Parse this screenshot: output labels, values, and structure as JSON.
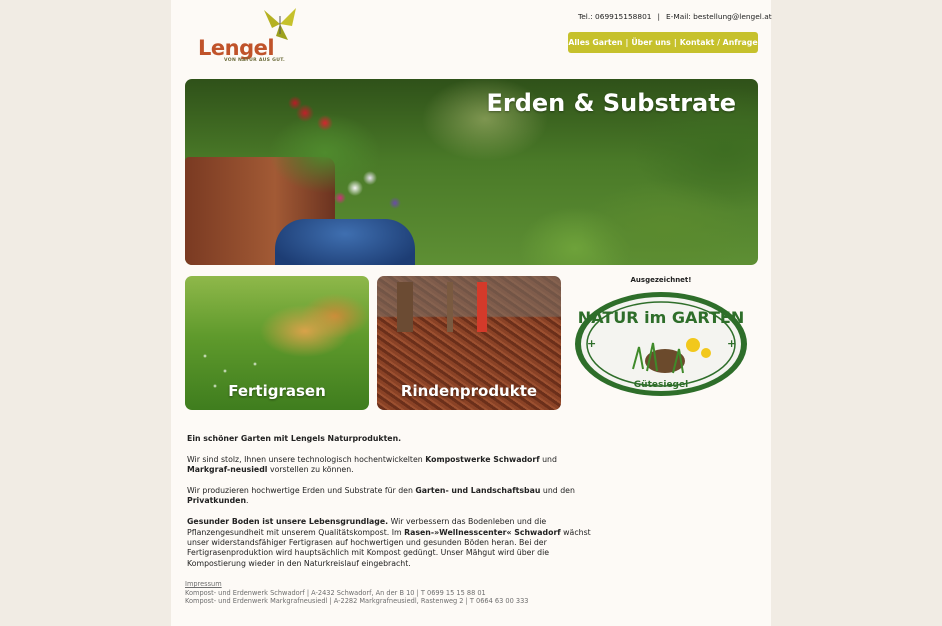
{
  "header": {
    "logo_text": "Lengel",
    "logo_tagline": "VON NATUR AUS GUT.",
    "phone": "Tel.: 069915158801",
    "separator": "|",
    "email": "E-Mail: bestellung@lengel.at"
  },
  "nav": {
    "items": [
      "Alles Garten",
      "Über uns",
      "Kontakt / Anfrage"
    ],
    "divider": "|"
  },
  "hero": {
    "title": "Erden & Substrate"
  },
  "tiles": [
    {
      "label": "Fertigrasen"
    },
    {
      "label": "Rindenprodukte"
    }
  ],
  "award": {
    "caption": "Ausgezeichnet!",
    "seal_text": "NATUR im GARTEN",
    "seal_sub": "Gütesiegel"
  },
  "content": {
    "p1_bold": "Ein schöner Garten mit Lengels Naturprodukten.",
    "p2_a": "Wir sind stolz, Ihnen unsere technologisch hochentwickelten ",
    "p2_b": "Kompostwerke Schwadorf",
    "p2_c": " und ",
    "p2_d": "Markgraf-neusiedl",
    "p2_e": " vorstellen zu können.",
    "p3_a": "Wir produzieren hochwertige Erden und Substrate für den ",
    "p3_b": "Garten- und Landschaftsbau",
    "p3_c": " und den ",
    "p3_d": "Privatkunden",
    "p3_e": ".",
    "p4_a": "Gesunder Boden ist unsere Lebensgrundlage.",
    "p4_b": " Wir verbessern das Bodenleben und die Pflanzengesundheit mit unserem Qualitätskompost. Im ",
    "p4_c": "Rasen-»Wellnesscenter« Schwadorf",
    "p4_d": " wächst unser widerstandsfähiger Fertigrasen auf hochwertigen und gesunden Böden heran. Bei der Fertigrasenproduktion wird hauptsächlich mit Kompost gedüngt. Unser Mähgut wird über die Kompostierung wieder in den Naturkreislauf eingebracht."
  },
  "footer": {
    "impressum": "Impressum",
    "line1": "Kompost- und Erdenwerk Schwadorf | A-2432 Schwadorf, An der B 10 | T 0699 15 15 88 01",
    "line2": "Kompost- und Erdenwerk Markgrafneusiedl | A-2282 Markgrafneusiedl, Rastenweg 2 | T 0664 63 00 333"
  },
  "colors": {
    "brand_orange": "#c0532a",
    "nav_green": "#c6c12c",
    "seal_green": "#2e6e2a"
  },
  "icons": [
    "butterfly-logo-icon",
    "natur-im-garten-seal-icon"
  ]
}
